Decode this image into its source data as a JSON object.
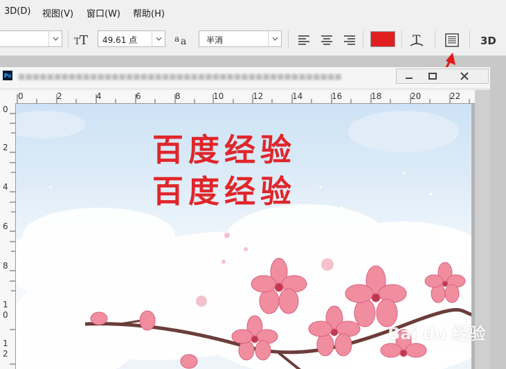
{
  "menu": {
    "items": [
      "3D(D)",
      "视图(V)",
      "窗口(W)",
      "帮助(H)"
    ]
  },
  "options": {
    "font_size": "49.61 点",
    "antialias": "半消",
    "text_color": "#e02020",
    "icons": [
      "font-size-icon",
      "antialias-icon",
      "align-left-icon",
      "align-center-icon",
      "align-right-icon",
      "warp-text-icon",
      "character-panel-icon",
      "3d-icon"
    ]
  },
  "document": {
    "ruler_top": [
      "0",
      "2",
      "4",
      "6",
      "8",
      "10",
      "12",
      "14",
      "16",
      "18",
      "20",
      "22"
    ],
    "ruler_left": [
      "0",
      "2",
      "4",
      "6",
      "8",
      "1",
      "0",
      "1",
      "2"
    ]
  },
  "canvas": {
    "line1": "百度经验",
    "line2": "百度经验",
    "watermark": "Bai du 经验"
  },
  "colors": {
    "accent_red": "#e0262a",
    "sky": "#cde3f6",
    "blossom": "#f08ea0"
  }
}
